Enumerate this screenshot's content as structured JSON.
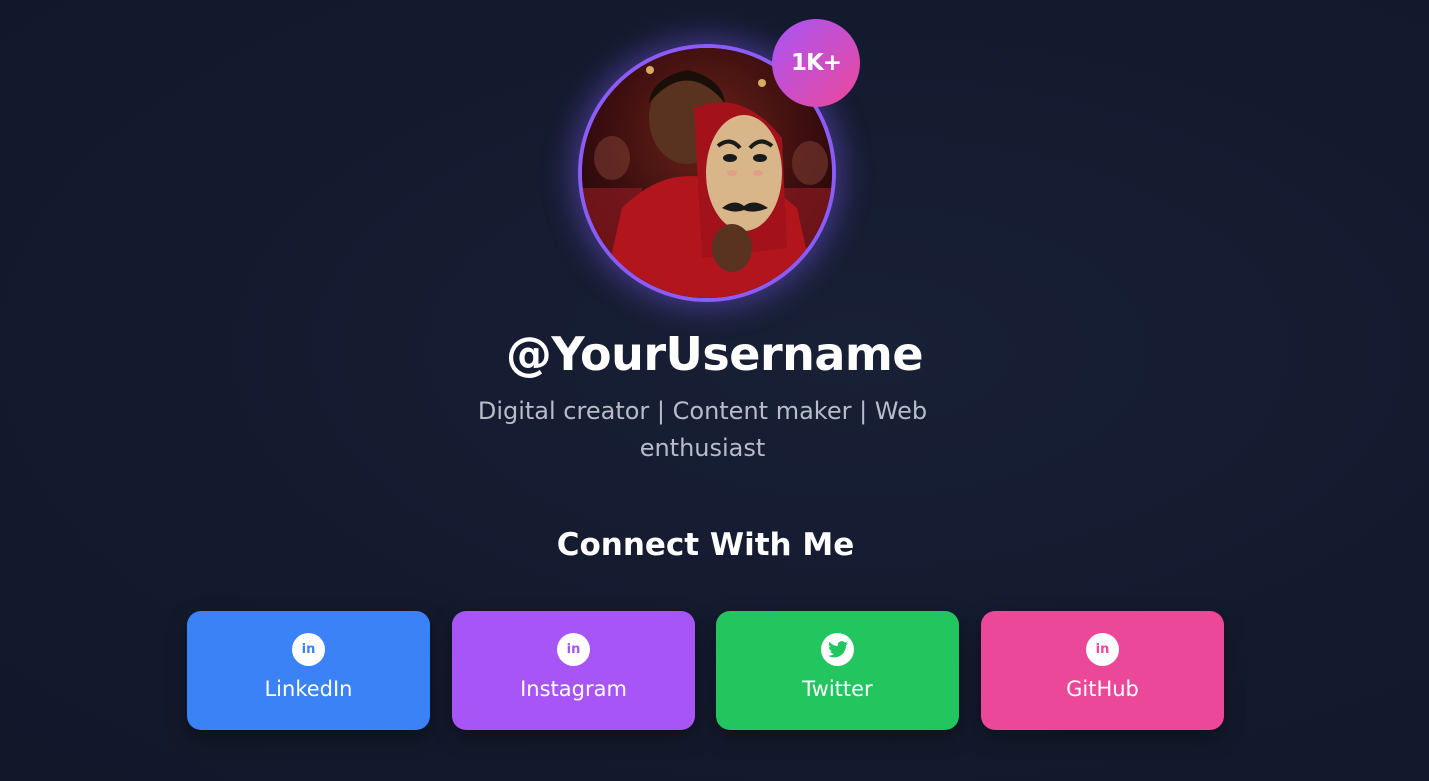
{
  "profile": {
    "badge": "1K+",
    "username": "@YourUsername",
    "bio": "Digital creator | Content maker | Web enthusiast"
  },
  "connect": {
    "title": "Connect With Me"
  },
  "links": [
    {
      "label": "LinkedIn",
      "icon": "linkedin-icon",
      "glyph": "in",
      "color": "#3b82f6"
    },
    {
      "label": "Instagram",
      "icon": "linkedin-icon",
      "glyph": "in",
      "color": "#a855f7"
    },
    {
      "label": "Twitter",
      "icon": "twitter-icon",
      "glyph": "",
      "color": "#22c55e"
    },
    {
      "label": "GitHub",
      "icon": "linkedin-icon",
      "glyph": "in",
      "color": "#ec4899"
    }
  ]
}
